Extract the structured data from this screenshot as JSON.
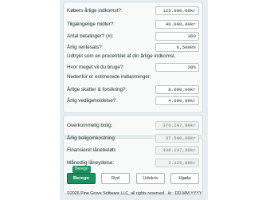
{
  "fields": [
    {
      "label": "Købers årlige indkomst?:",
      "value": "125.000,00kr"
    },
    {
      "label": "Tilgængelige midler?:",
      "value": "40.000,00kr"
    },
    {
      "label": "Antal betalinger? (#):",
      "value": "360"
    },
    {
      "label": "Årlig rentesats?:",
      "value": "6,5000%"
    }
  ],
  "percent_question": {
    "line1": "Udtrykt som en procentdel af din årlige indkomst,",
    "line2": "Hvor meget vil du bruge?:",
    "value": "38%"
  },
  "estimates": {
    "heading": "Nedenfor er estimerede indtastninger:",
    "tax_label": "Årlige skatter & forsikring?:",
    "tax_value": "8.000,00kr",
    "maintenance_label": "Årlig vedligeholdelse?:",
    "maintenance_value": "4.000,00kr"
  },
  "results": [
    {
      "label": "Overkommelig bolig:",
      "value": "376.197,99kr"
    },
    {
      "label": "Årlig boligomkostning:",
      "value": "37.500,00kr"
    },
    {
      "label": "Finansieret lånebeløb:",
      "value": "336.197,99kr"
    },
    {
      "label": "Månedlig låneydelse:",
      "value": "2.125,00kr"
    }
  ],
  "buttons": {
    "compute": "Beregn",
    "clear": "Ryd",
    "print": "Udskriv",
    "help": "Hjælp"
  },
  "tooltip": "Beregn",
  "footer": "©2026 Pine Grove Software LLC, all rights reserved  ·  år : DD.MM.YYYY",
  "colors": {
    "accent": "#1e8f5e"
  }
}
